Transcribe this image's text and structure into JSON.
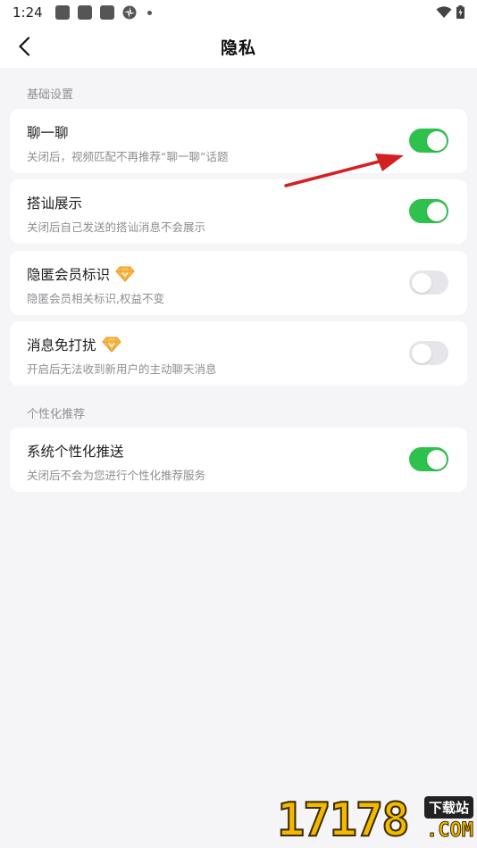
{
  "status_bar": {
    "time": "1:24"
  },
  "header": {
    "title": "隐私",
    "back_icon": "chevron-left-icon"
  },
  "sections": [
    {
      "label": "基础设置",
      "items": [
        {
          "title": "聊一聊",
          "desc": "关闭后，视频匹配不再推荐“聊一聊”话题",
          "enabled": true,
          "vip": false
        },
        {
          "title": "搭讪展示",
          "desc": "关闭后自己发送的搭讪消息不会展示",
          "enabled": true,
          "vip": false
        },
        {
          "title": "隐匿会员标识",
          "desc": "隐匿会员相关标识,权益不变",
          "enabled": false,
          "vip": true
        },
        {
          "title": "消息免打扰",
          "desc": "开启后无法收到新用户的主动聊天消息",
          "enabled": false,
          "vip": true
        }
      ]
    },
    {
      "label": "个性化推荐",
      "items": [
        {
          "title": "系统个性化推送",
          "desc": "关闭后不会为您进行个性化推荐服务",
          "enabled": true,
          "vip": false
        }
      ]
    }
  ],
  "colors": {
    "toggle_on": "#2fc14e",
    "toggle_off": "#e6e6ea",
    "annotation_arrow": "#d42020",
    "vip_gem": "#f5a623"
  },
  "watermark": {
    "number": "17178",
    "tag": "下载站",
    "suffix": ".COM"
  }
}
